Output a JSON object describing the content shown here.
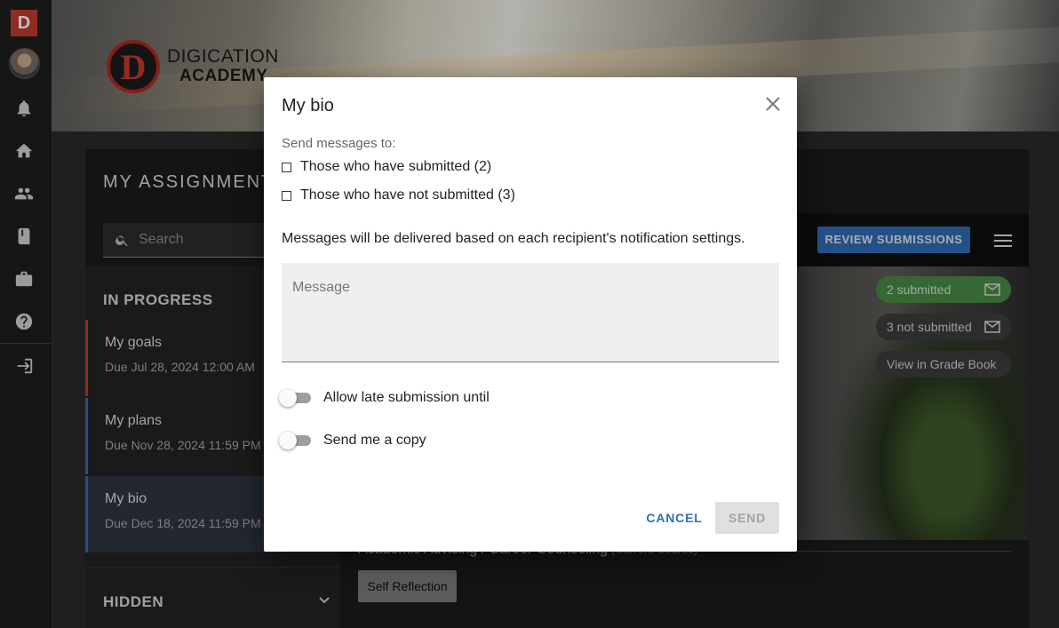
{
  "rail": {
    "logo_letter": "D",
    "icons": [
      "bell-icon",
      "home-icon",
      "people-icon",
      "book-icon",
      "briefcase-icon",
      "help-icon",
      "logout-icon"
    ]
  },
  "brand": {
    "mark_letter": "D",
    "line1": "DIGICATION",
    "line2": "ACADEMY"
  },
  "panel": {
    "title": "MY ASSIGNMENTS",
    "search_placeholder": "Search",
    "in_progress_label": "IN PROGRESS",
    "items": [
      {
        "title": "My goals",
        "due": "Due Jul 28, 2024 12:00 AM"
      },
      {
        "title": "My plans",
        "due": "Due Nov 28, 2024 11:59 PM"
      },
      {
        "title": "My bio",
        "due": "Due Dec 18, 2024 11:59 PM"
      }
    ],
    "hidden_label": "HIDDEN",
    "review_label": "REVIEW SUBMISSIONS",
    "pills": {
      "submitted": "2 submitted",
      "not_submitted": "3 not submitted",
      "grade_book": "View in Grade Book"
    },
    "course": "Academic Advising / Career Counseling",
    "course_note": "(Current Course)",
    "tag": "Self Reflection"
  },
  "dialog": {
    "title": "My bio",
    "send_to_label": "Send messages to:",
    "option_submitted": "Those who have submitted (2)",
    "option_not_submitted": "Those who have not submitted (3)",
    "note": "Messages will be delivered based on each recipient's notification settings.",
    "message_placeholder": "Message",
    "late_label": "Allow late submission until",
    "copy_label": "Send me a copy",
    "cancel_label": "CANCEL",
    "send_label": "SEND"
  },
  "colors": {
    "accent": "#2f6db5",
    "brand_red": "#c23b2e",
    "submitted_green": "#4a8a46"
  }
}
